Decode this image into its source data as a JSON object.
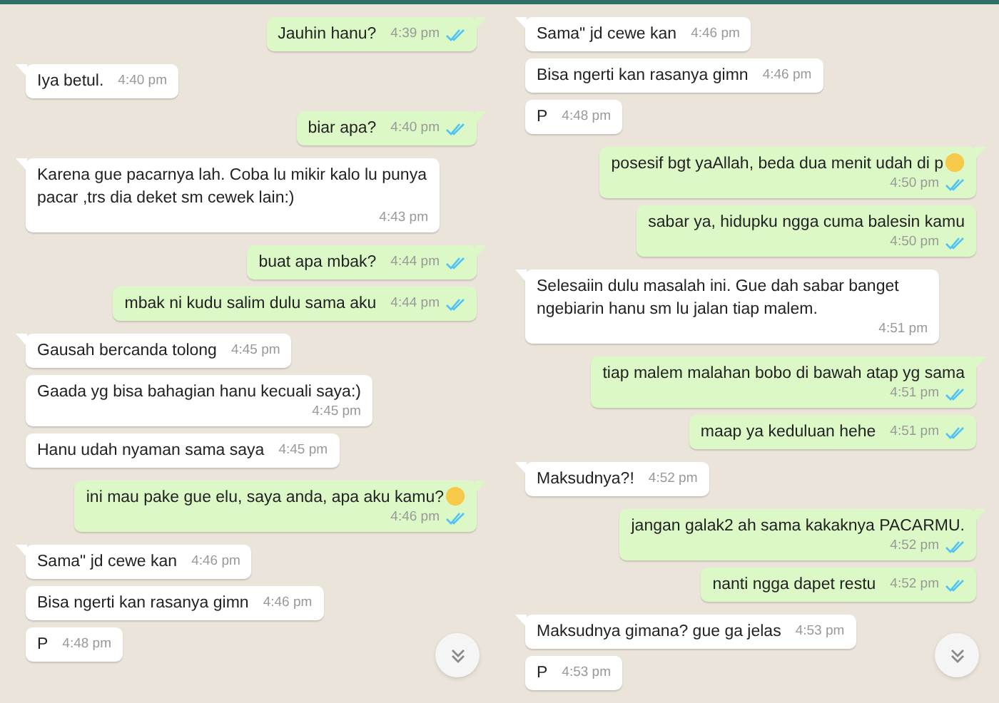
{
  "panels": [
    {
      "messages": [
        {
          "kind": "sent",
          "tail": true,
          "text": "Jauhin hanu?",
          "time": "4:39 pm",
          "read": true,
          "stacked": false,
          "emoji": false
        },
        {
          "kind": "received",
          "tail": true,
          "text": "Iya betul.",
          "time": "4:40 pm",
          "stacked": false,
          "emoji": false
        },
        {
          "kind": "sent",
          "tail": true,
          "text": "biar apa?",
          "time": "4:40 pm",
          "read": true,
          "stacked": false,
          "emoji": false
        },
        {
          "kind": "received",
          "tail": true,
          "text": "Karena gue pacarnya lah. Coba lu mikir kalo lu punya pacar ,trs dia deket sm cewek lain:)",
          "time": "4:43 pm",
          "stacked": true,
          "emoji": false
        },
        {
          "kind": "sent",
          "tail": true,
          "text": "buat apa mbak?",
          "time": "4:44 pm",
          "read": true,
          "stacked": false,
          "emoji": false
        },
        {
          "kind": "sent",
          "tail": false,
          "text": "mbak ni kudu salim dulu sama aku",
          "time": "4:44 pm",
          "read": true,
          "stacked": false,
          "emoji": false
        },
        {
          "kind": "received",
          "tail": true,
          "text": "Gausah bercanda tolong",
          "time": "4:45 pm",
          "stacked": false,
          "emoji": false
        },
        {
          "kind": "received",
          "tail": false,
          "text": "Gaada yg bisa bahagian hanu kecuali saya:)",
          "time": "4:45 pm",
          "stacked": true,
          "emoji": false
        },
        {
          "kind": "received",
          "tail": false,
          "text": "Hanu udah nyaman sama saya",
          "time": "4:45 pm",
          "stacked": false,
          "emoji": false
        },
        {
          "kind": "sent",
          "tail": true,
          "text": "ini mau pake gue elu, saya anda, apa aku kamu?",
          "time": "4:46 pm",
          "read": true,
          "stacked": true,
          "emoji": true
        },
        {
          "kind": "received",
          "tail": true,
          "text": "Sama\" jd cewe kan",
          "time": "4:46 pm",
          "stacked": false,
          "emoji": false
        },
        {
          "kind": "received",
          "tail": false,
          "text": "Bisa ngerti kan rasanya gimn",
          "time": "4:46 pm",
          "stacked": false,
          "emoji": false
        },
        {
          "kind": "received",
          "tail": false,
          "text": "P",
          "time": "4:48 pm",
          "stacked": false,
          "emoji": false
        }
      ]
    },
    {
      "messages": [
        {
          "kind": "received",
          "tail": true,
          "text": "Sama\" jd cewe kan",
          "time": "4:46 pm",
          "stacked": false,
          "emoji": false
        },
        {
          "kind": "received",
          "tail": false,
          "text": "Bisa ngerti kan rasanya gimn",
          "time": "4:46 pm",
          "stacked": false,
          "emoji": false
        },
        {
          "kind": "received",
          "tail": false,
          "text": "P",
          "time": "4:48 pm",
          "stacked": false,
          "emoji": false
        },
        {
          "kind": "sent",
          "tail": true,
          "text": "posesif bgt yaAllah, beda dua menit udah di p",
          "time": "4:50 pm",
          "read": true,
          "stacked": true,
          "emoji": true
        },
        {
          "kind": "sent",
          "tail": false,
          "text": "sabar ya, hidupku ngga cuma balesin kamu",
          "time": "4:50 pm",
          "read": true,
          "stacked": true,
          "emoji": false
        },
        {
          "kind": "received",
          "tail": true,
          "text": "Selesaiin dulu masalah ini. Gue dah sabar banget ngebiarin hanu sm lu jalan tiap malem.",
          "time": "4:51 pm",
          "stacked": true,
          "emoji": false
        },
        {
          "kind": "sent",
          "tail": true,
          "text": "tiap malem malahan bobo di bawah atap yg sama",
          "time": "4:51 pm",
          "read": true,
          "stacked": true,
          "emoji": false
        },
        {
          "kind": "sent",
          "tail": false,
          "text": "maap ya keduluan hehe",
          "time": "4:51 pm",
          "read": true,
          "stacked": false,
          "emoji": false
        },
        {
          "kind": "received",
          "tail": true,
          "text": "Maksudnya?!",
          "time": "4:52 pm",
          "stacked": false,
          "emoji": false
        },
        {
          "kind": "sent",
          "tail": true,
          "text": "jangan galak2 ah sama kakaknya PACARMU.",
          "time": "4:52 pm",
          "read": true,
          "stacked": true,
          "emoji": false
        },
        {
          "kind": "sent",
          "tail": false,
          "text": "nanti ngga dapet restu",
          "time": "4:52 pm",
          "read": true,
          "stacked": false,
          "emoji": false
        },
        {
          "kind": "received",
          "tail": true,
          "text": "Maksudnya gimana? gue ga jelas",
          "time": "4:53 pm",
          "stacked": false,
          "emoji": false
        },
        {
          "kind": "received",
          "tail": false,
          "text": "P",
          "time": "4:53 pm",
          "stacked": false,
          "emoji": false
        }
      ]
    }
  ]
}
